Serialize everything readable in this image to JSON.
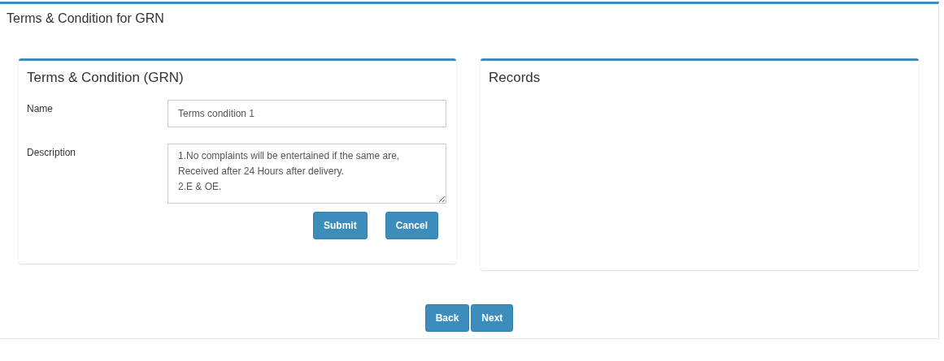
{
  "page": {
    "title": "Terms & Condition for GRN"
  },
  "form_card": {
    "title": "Terms & Condition (GRN)",
    "fields": [
      {
        "label": "Name",
        "kind": "input",
        "value": "Terms condition 1"
      },
      {
        "label": "Description",
        "kind": "textarea",
        "value": "1.No complaints will be entertained if the same are,\nReceived after 24 Hours after delivery.\n2.E & OE."
      }
    ],
    "buttons": [
      "Submit",
      "Cancel"
    ]
  },
  "records_card": {
    "title": "Records"
  },
  "nav_buttons": [
    "Back",
    "Next"
  ]
}
